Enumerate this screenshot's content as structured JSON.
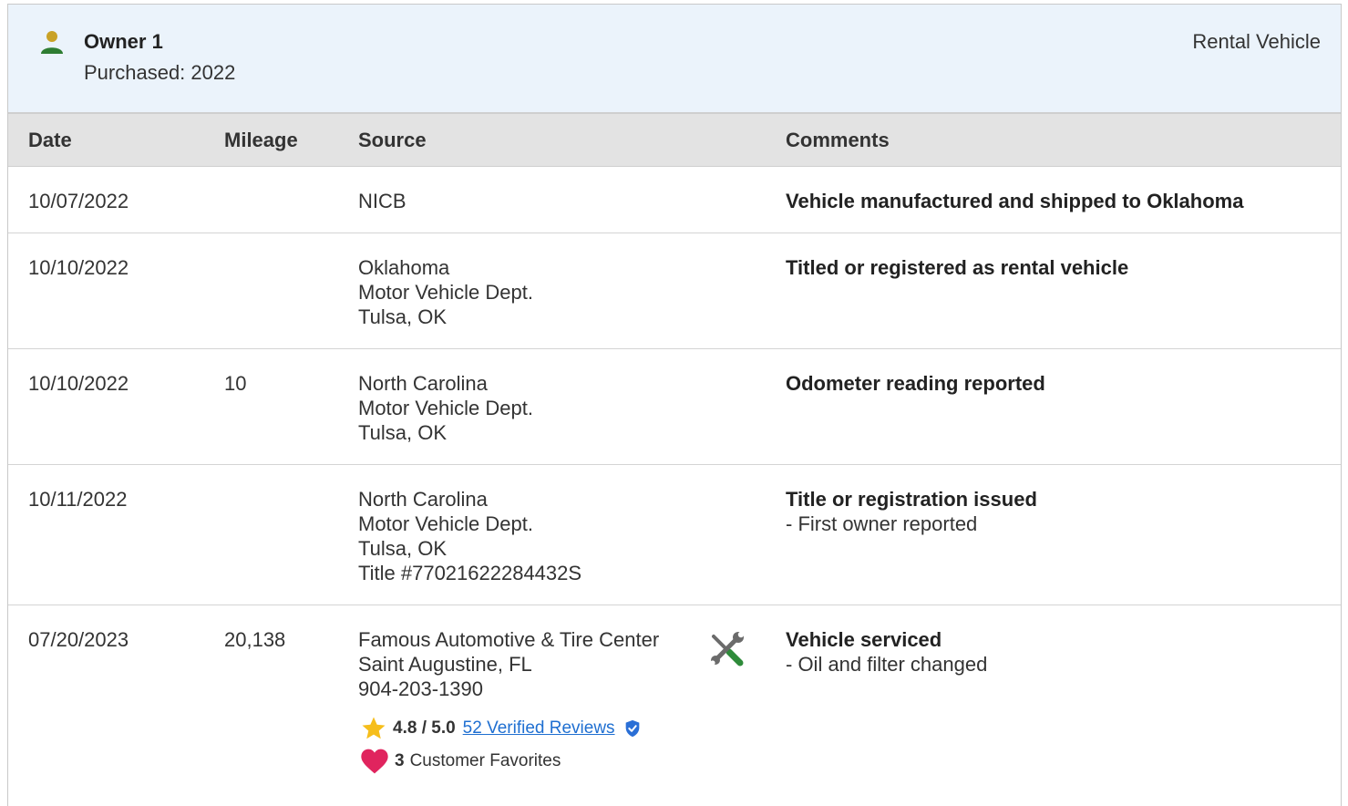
{
  "owner": {
    "title": "Owner 1",
    "purchased": "Purchased: 2022",
    "vehicle_type": "Rental Vehicle",
    "icon": "person-icon",
    "icon_color": "#2e7d32"
  },
  "table": {
    "headers": {
      "date": "Date",
      "mileage": "Mileage",
      "source": "Source",
      "comments": "Comments"
    },
    "rows": [
      {
        "date": "10/07/2022",
        "mileage": "",
        "source": [
          "NICB"
        ],
        "comment_title": "Vehicle manufactured and shipped to Oklahoma",
        "comment_detail": ""
      },
      {
        "date": "10/10/2022",
        "mileage": "",
        "source": [
          "Oklahoma",
          "Motor Vehicle Dept.",
          "Tulsa, OK"
        ],
        "comment_title": "Titled or registered as rental vehicle",
        "comment_detail": ""
      },
      {
        "date": "10/10/2022",
        "mileage": "10",
        "source": [
          "North Carolina",
          "Motor Vehicle Dept.",
          "Tulsa, OK"
        ],
        "comment_title": "Odometer reading reported",
        "comment_detail": ""
      },
      {
        "date": "10/11/2022",
        "mileage": "",
        "source": [
          "North Carolina",
          "Motor Vehicle Dept.",
          "Tulsa, OK",
          "Title #77021622284432S"
        ],
        "comment_title": "Title or registration issued",
        "comment_detail": "- First owner reported"
      },
      {
        "date": "07/20/2023",
        "mileage": "20,138",
        "source": [
          "Famous Automotive & Tire Center",
          "Saint Augustine, FL",
          "904-203-1390"
        ],
        "comment_title": "Vehicle serviced",
        "comment_detail": "- Oil and filter changed",
        "service_icon": "wrench-screwdriver-icon",
        "rating": "4.8 / 5.0",
        "reviews_link": "52 Verified Reviews",
        "favorites_count": "3",
        "favorites_label": "Customer Favorites"
      }
    ]
  },
  "colors": {
    "header_bg": "#ebf3fb",
    "table_header_bg": "#e3e3e3",
    "link": "#1f6fd1",
    "star": "#f6be1b",
    "heart": "#e0245e",
    "verified": "#2a6fd6",
    "tool_green": "#2e8b3a"
  }
}
